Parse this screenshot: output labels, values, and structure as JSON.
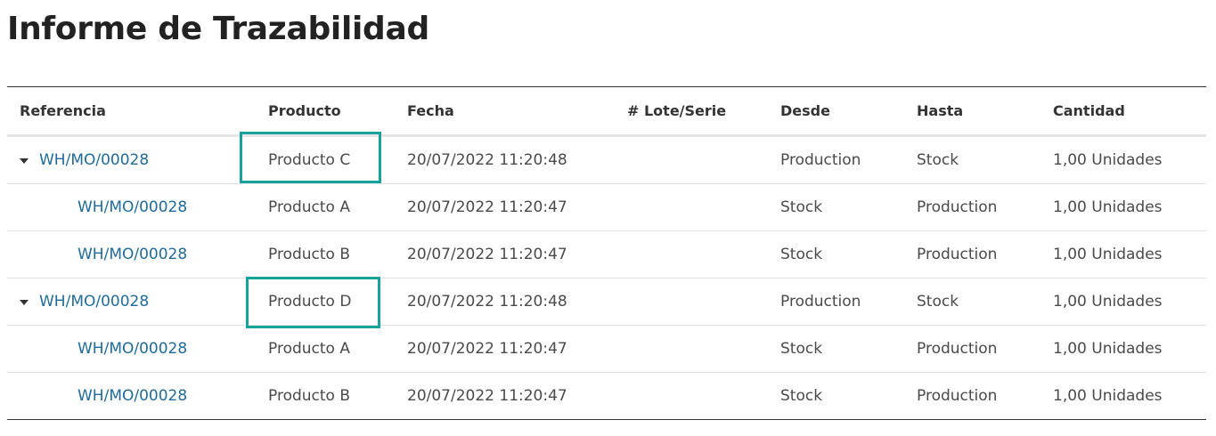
{
  "page": {
    "title": "Informe de Trazabilidad"
  },
  "columns": {
    "reference": "Referencia",
    "product": "Producto",
    "date": "Fecha",
    "lot": "# Lote/Serie",
    "from": "Desde",
    "to": "Hasta",
    "quantity": "Cantidad"
  },
  "rows": [
    {
      "reference": "WH/MO/00028",
      "product": "Producto C",
      "date": "20/07/2022 11:20:48",
      "lot": "",
      "from": "Production",
      "to": "Stock",
      "quantity": "1,00 Unidades",
      "expandable": true,
      "highlighted": true
    },
    {
      "reference": "WH/MO/00028",
      "product": "Producto A",
      "date": "20/07/2022 11:20:47",
      "lot": "",
      "from": "Stock",
      "to": "Production",
      "quantity": "1,00 Unidades",
      "expandable": false,
      "highlighted": false
    },
    {
      "reference": "WH/MO/00028",
      "product": "Producto B",
      "date": "20/07/2022 11:20:47",
      "lot": "",
      "from": "Stock",
      "to": "Production",
      "quantity": "1,00 Unidades",
      "expandable": false,
      "highlighted": false
    },
    {
      "reference": "WH/MO/00028",
      "product": "Producto D",
      "date": "20/07/2022 11:20:48",
      "lot": "",
      "from": "Production",
      "to": "Stock",
      "quantity": "1,00 Unidades",
      "expandable": true,
      "highlighted": true
    },
    {
      "reference": "WH/MO/00028",
      "product": "Producto A",
      "date": "20/07/2022 11:20:47",
      "lot": "",
      "from": "Stock",
      "to": "Production",
      "quantity": "1,00 Unidades",
      "expandable": false,
      "highlighted": false
    },
    {
      "reference": "WH/MO/00028",
      "product": "Producto B",
      "date": "20/07/2022 11:20:47",
      "lot": "",
      "from": "Stock",
      "to": "Production",
      "quantity": "1,00 Unidades",
      "expandable": false,
      "highlighted": false
    }
  ],
  "colors": {
    "link": "#1f6b9a",
    "highlight": "#17a2a0"
  },
  "icons": {
    "expand": "caret-down-icon"
  }
}
